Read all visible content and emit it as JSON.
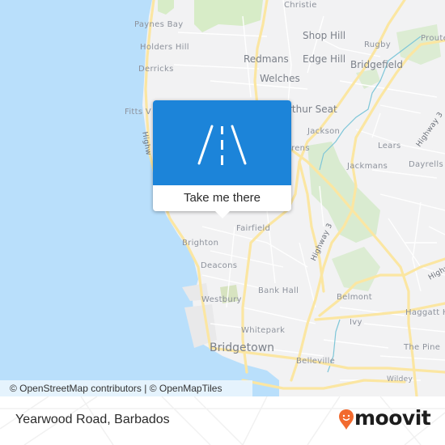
{
  "map": {
    "colors": {
      "water": "#b9dffb",
      "land": "#f2f2f3",
      "park": "#d7ecc7",
      "road_major": "#fbe6a2",
      "road_minor": "#ffffff",
      "river": "#7ec6d8"
    },
    "places": [
      {
        "name": "Christie",
        "size": "small"
      },
      {
        "name": "Paynes Bay",
        "size": "small"
      },
      {
        "name": "Shop Hill",
        "size": "big"
      },
      {
        "name": "Rugby",
        "size": "small"
      },
      {
        "name": "Proute",
        "size": "small"
      },
      {
        "name": "Holders Hill",
        "size": "small"
      },
      {
        "name": "Redmans",
        "size": "big"
      },
      {
        "name": "Edge Hill",
        "size": "big"
      },
      {
        "name": "Derricks",
        "size": "small"
      },
      {
        "name": "Bridgefield",
        "size": "big"
      },
      {
        "name": "Welches",
        "size": "big"
      },
      {
        "name": "Fitts V",
        "size": "small"
      },
      {
        "name": "rthur Seat",
        "size": "big"
      },
      {
        "name": "Jackson",
        "size": "small"
      },
      {
        "name": "rens",
        "size": "small"
      },
      {
        "name": "Lears",
        "size": "small"
      },
      {
        "name": "Jackmans",
        "size": "small"
      },
      {
        "name": "Dayrells",
        "size": "small"
      },
      {
        "name": "Fairfield",
        "size": "small"
      },
      {
        "name": "Brighton",
        "size": "small"
      },
      {
        "name": "Deacons",
        "size": "small"
      },
      {
        "name": "Bank Hall",
        "size": "small"
      },
      {
        "name": "Westbury",
        "size": "small"
      },
      {
        "name": "Belmont",
        "size": "small"
      },
      {
        "name": "Haggatt H",
        "size": "small"
      },
      {
        "name": "Ivy",
        "size": "small"
      },
      {
        "name": "Whitepark",
        "size": "small"
      },
      {
        "name": "The Pine",
        "size": "small"
      },
      {
        "name": "Bridgetown",
        "size": "city"
      },
      {
        "name": "Belleville",
        "size": "small"
      },
      {
        "name": "Wildey",
        "size": "small"
      }
    ],
    "road_labels": [
      "Highway 3",
      "Highway 3",
      "Highw",
      "Highw"
    ],
    "attribution": "© OpenStreetMap contributors | © OpenMapTiles"
  },
  "popup": {
    "icon": "road-icon",
    "action_label": "Take me there",
    "color": "#1c84d9"
  },
  "footer": {
    "location": "Yearwood Road, Barbados",
    "brand": "moovit",
    "brand_color": "#f26a2e"
  }
}
